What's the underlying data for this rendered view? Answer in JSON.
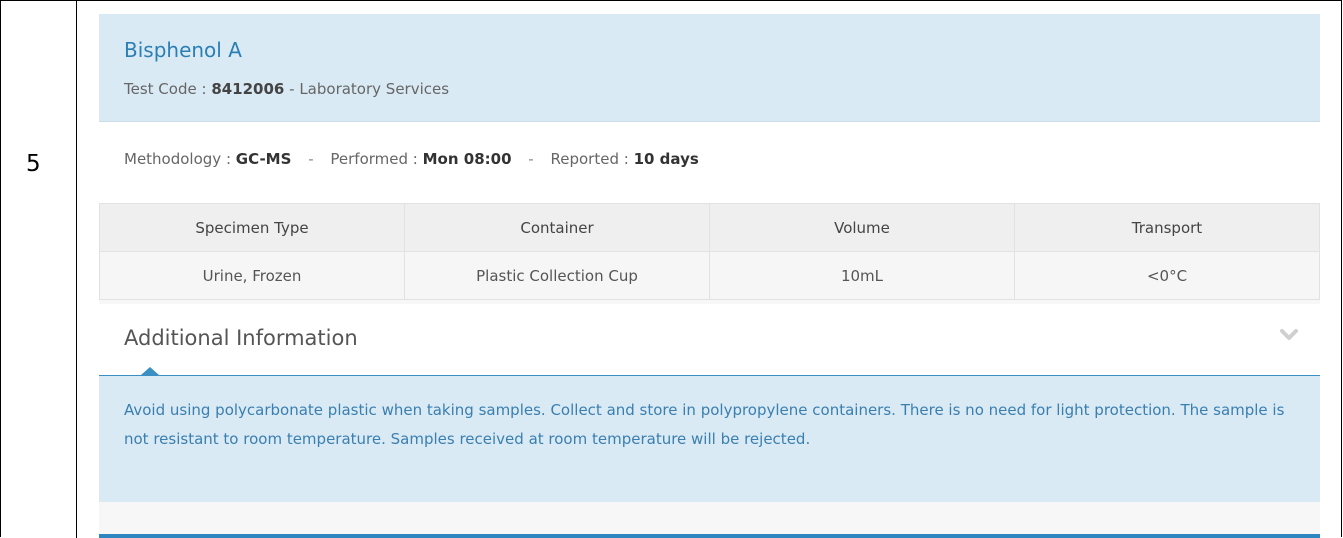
{
  "row_number": "5",
  "test": {
    "name": "Bisphenol A",
    "code_label": "Test Code : ",
    "code": "8412006",
    "department": " - Laboratory Services"
  },
  "meta": {
    "methodology_label": "Methodology : ",
    "methodology": "GC-MS",
    "performed_label": "Performed : ",
    "performed": "Mon 08:00",
    "reported_label": "Reported : ",
    "reported": "10 days",
    "separator": "-"
  },
  "specimen_table": {
    "headers": [
      "Specimen Type",
      "Container",
      "Volume",
      "Transport"
    ],
    "rows": [
      [
        "Urine, Frozen",
        "Plastic Collection Cup",
        "10mL",
        "<0°C"
      ]
    ]
  },
  "additional_info": {
    "title": "Additional Information",
    "chevron_icon": "chevron-down-icon",
    "text": "Avoid using polycarbonate plastic when taking samples. Collect and store in polypropylene containers. There is no need for light protection. The sample is not resistant to room temperature. Samples received at room temperature will be rejected."
  },
  "colors": {
    "header_bg": "#d9eaf4",
    "title_blue": "#2b7fb4",
    "accent_blue": "#2e86c1"
  }
}
